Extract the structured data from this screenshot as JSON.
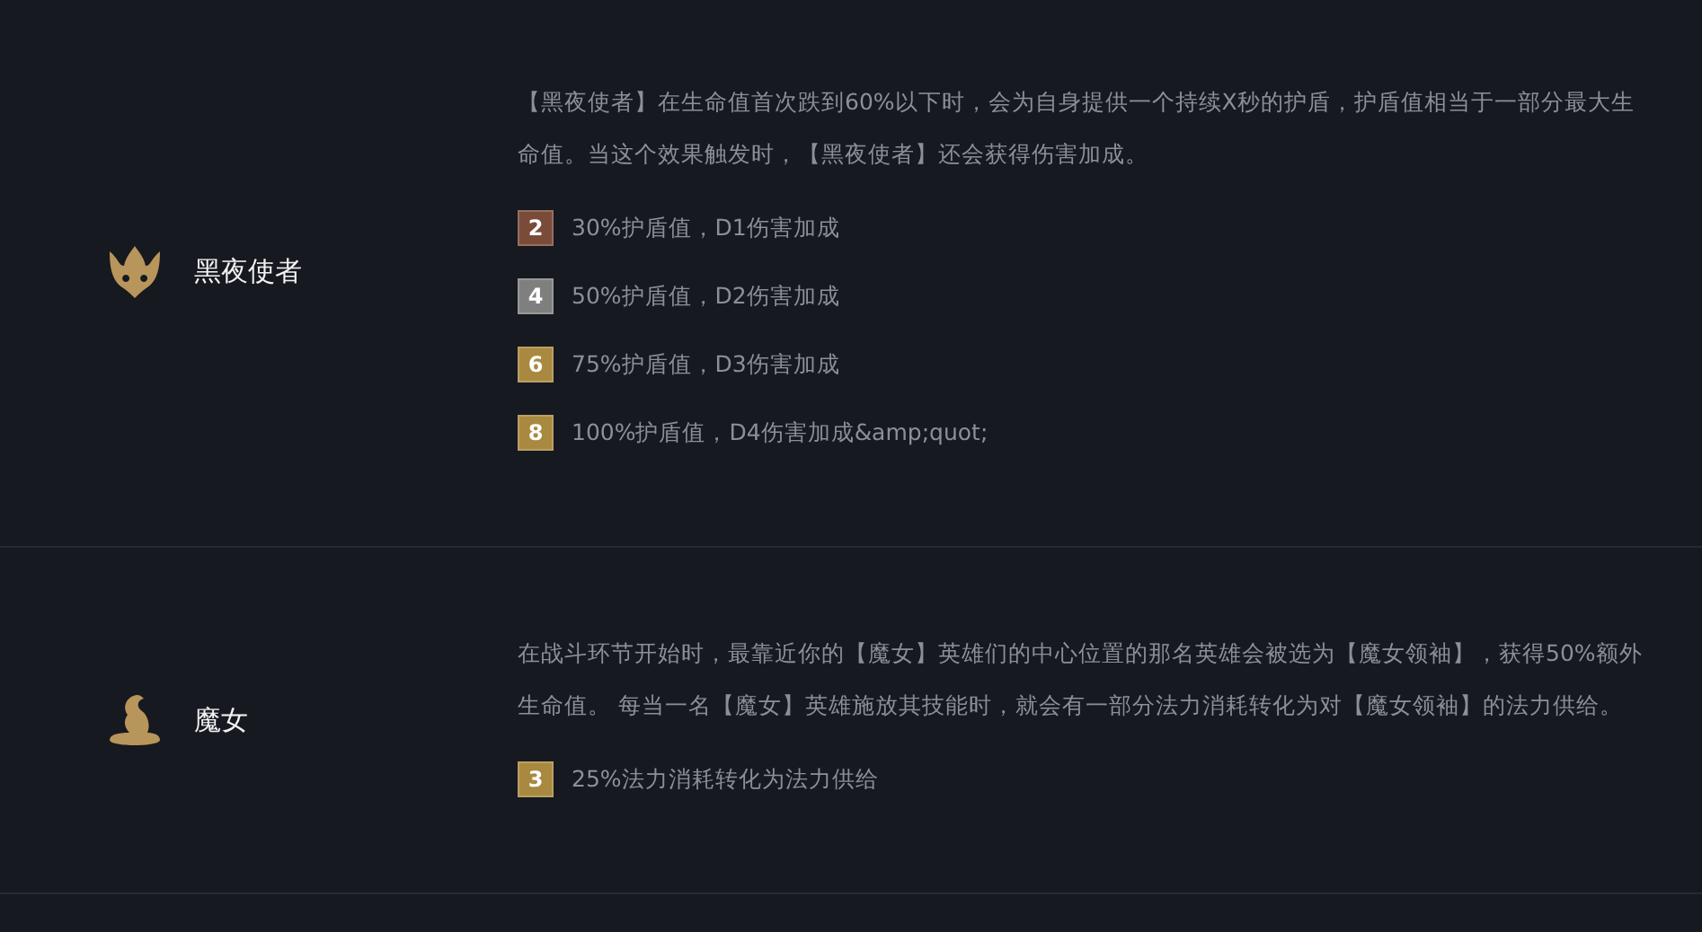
{
  "traits": [
    {
      "kind": "mask",
      "name": "黑夜使者",
      "description": "【黑夜使者】在生命值首次跌到60%以下时，会为自身提供一个持续X秒的护盾，护盾值相当于一部分最大生命值。当这个效果触发时，【黑夜使者】还会获得伤害加成。",
      "tiers": [
        {
          "count": "2",
          "color": "#7b4b3a",
          "text": "30%护盾值，D1伤害加成"
        },
        {
          "count": "4",
          "color": "#7f7f7f",
          "text": "50%护盾值，D2伤害加成"
        },
        {
          "count": "6",
          "color": "#a8893f",
          "text": "75%护盾值，D3伤害加成"
        },
        {
          "count": "8",
          "color": "#a8893f",
          "text": "100%护盾值，D4伤害加成&amp;quot;"
        }
      ]
    },
    {
      "kind": "hat",
      "name": "魔女",
      "description": "在战斗环节开始时，最靠近你的【魔女】英雄们的中心位置的那名英雄会被选为【魔女领袖】，获得50%额外生命值。 每当一名【魔女】英雄施放其技能时，就会有一部分法力消耗转化为对【魔女领袖】的法力供给。",
      "tiers": [
        {
          "count": "3",
          "color": "#a8893f",
          "text": "25%法力消耗转化为法力供给"
        }
      ]
    }
  ]
}
